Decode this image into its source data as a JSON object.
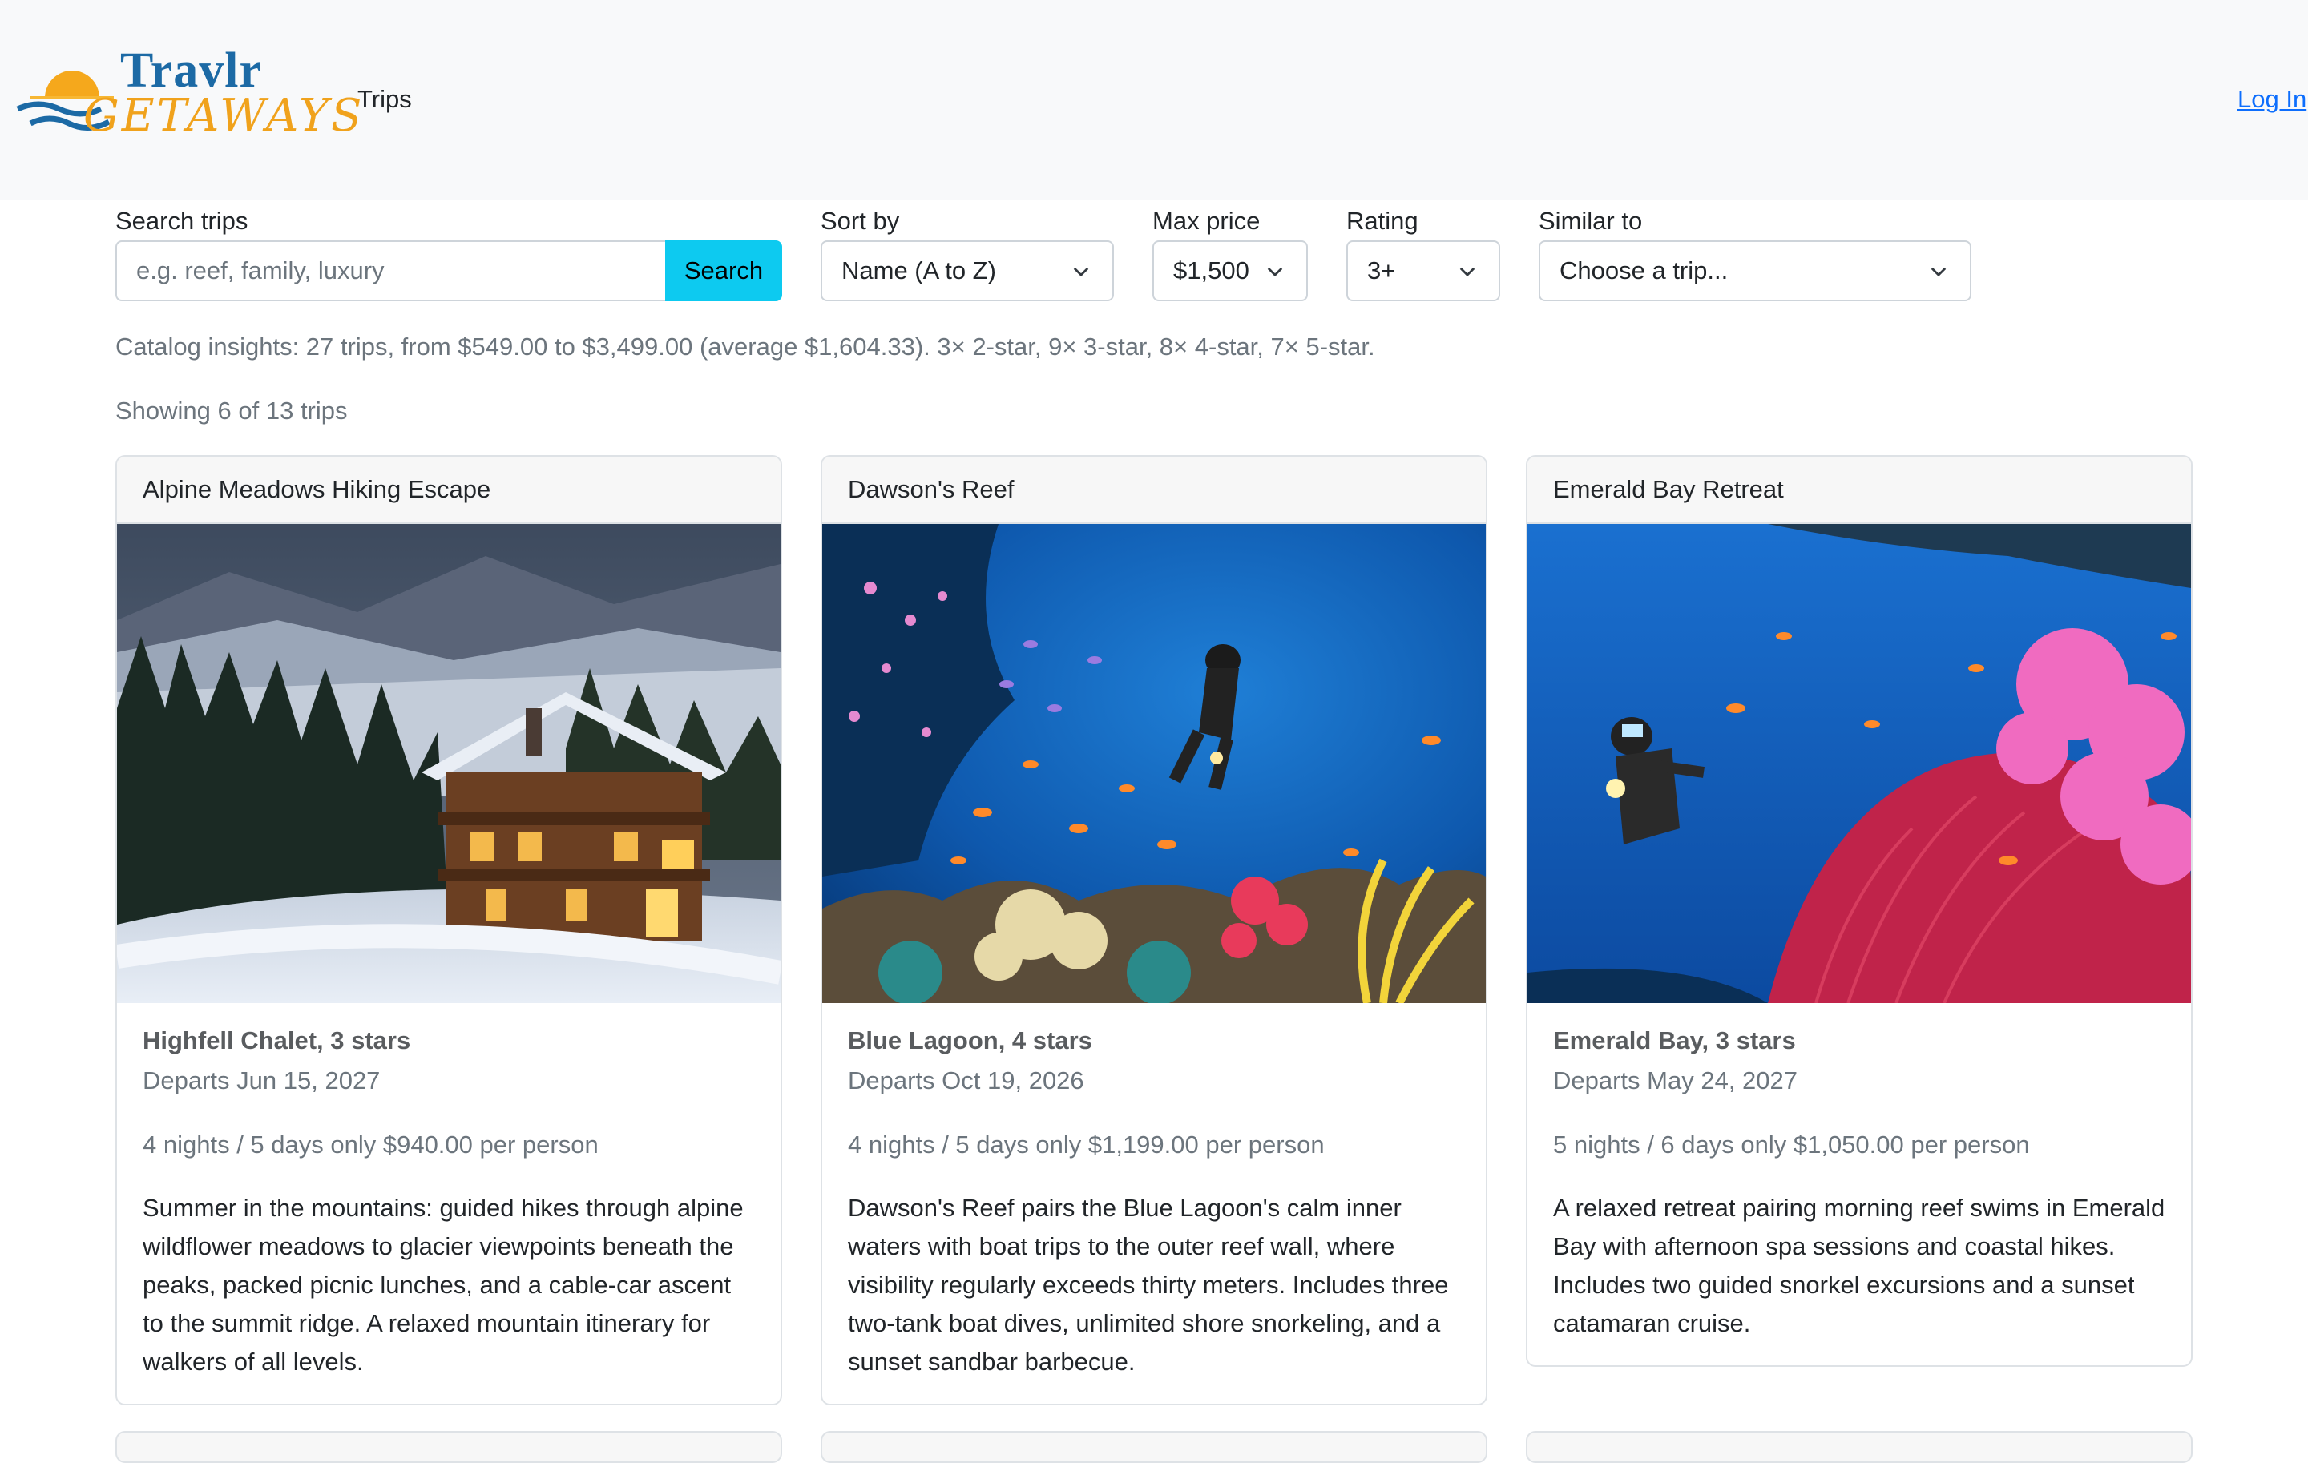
{
  "brand": {
    "line1": "Travlr",
    "line2": "GETAWAYS"
  },
  "nav": {
    "trips": "Trips",
    "login": "Log In"
  },
  "filters": {
    "search_label": "Search trips",
    "search_placeholder": "e.g. reef, family, luxury",
    "search_button": "Search",
    "sort_label": "Sort by",
    "sort_value": "Name (A to Z)",
    "price_label": "Max price",
    "price_value": "$1,500",
    "rating_label": "Rating",
    "rating_value": "3+",
    "similar_label": "Similar to",
    "similar_value": "Choose a trip..."
  },
  "insights": "Catalog insights: 27 trips, from $549.00 to $3,499.00 (average $1,604.33). 3× 2-star, 9× 3-star, 8× 4-star, 7× 5-star.",
  "showing": "Showing 6 of 13 trips",
  "cards": [
    {
      "title": "Alpine Meadows Hiking Escape",
      "location": "Highfell Chalet, 3 stars",
      "departs": "Departs Jun 15, 2027",
      "price": "4 nights / 5 days only $940.00 per person",
      "description": "Summer in the mountains: guided hikes through alpine wildflower meadows to glacier viewpoints beneath the peaks, packed picnic lunches, and a cable-car ascent to the summit ridge. A relaxed mountain itinerary for walkers of all levels."
    },
    {
      "title": "Dawson's Reef",
      "location": "Blue Lagoon, 4 stars",
      "departs": "Departs Oct 19, 2026",
      "price": "4 nights / 5 days only $1,199.00 per person",
      "description": "Dawson's Reef pairs the Blue Lagoon's calm inner waters with boat trips to the outer reef wall, where visibility regularly exceeds thirty meters. Includes three two-tank boat dives, unlimited shore snorkeling, and a sunset sandbar barbecue."
    },
    {
      "title": "Emerald Bay Retreat",
      "location": "Emerald Bay, 3 stars",
      "departs": "Departs May 24, 2027",
      "price": "5 nights / 6 days only $1,050.00 per person",
      "description": "A relaxed retreat pairing morning reef swims in Emerald Bay with afternoon spa sessions and coastal hikes. Includes two guided snorkel excursions and a sunset catamaran cruise."
    }
  ]
}
